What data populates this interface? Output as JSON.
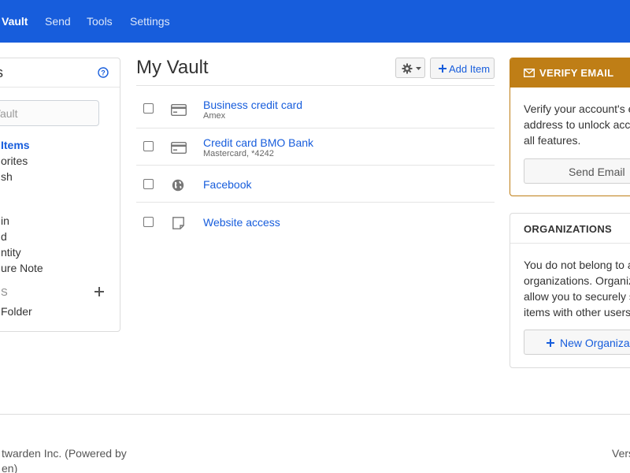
{
  "nav": {
    "items": [
      {
        "label": "Vault",
        "active": true
      },
      {
        "label": "Send",
        "active": false
      },
      {
        "label": "Tools",
        "active": false
      },
      {
        "label": "Settings",
        "active": false
      }
    ]
  },
  "filters": {
    "title": "s",
    "search_placeholder": "n Vault",
    "all_items": "Items",
    "favorites": "orites",
    "trash": "sh",
    "types": [
      "in",
      "d",
      "ntity",
      "ure Note"
    ],
    "folders_label": "S",
    "no_folder": "Folder"
  },
  "main": {
    "title": "My Vault",
    "add_item_label": "Add Item",
    "items": [
      {
        "name": "Business credit card",
        "sub": "Amex",
        "type": "card-icon"
      },
      {
        "name": "Credit card BMO Bank",
        "sub": "Mastercard, *4242",
        "type": "card-icon"
      },
      {
        "name": "Facebook",
        "sub": "",
        "type": "globe-icon"
      },
      {
        "name": "Website access",
        "sub": "",
        "type": "note-icon"
      }
    ]
  },
  "verify": {
    "title": "VERIFY EMAIL",
    "lines": [
      "Verify your account's e",
      "address to unlock acce",
      "all features."
    ],
    "button": "Send Email"
  },
  "orgs": {
    "title": "ORGANIZATIONS",
    "lines": [
      "You do not belong to a",
      "organizations. Organiz",
      "allow you to securely s",
      "items with other users"
    ],
    "button": "New Organizat"
  },
  "footer": {
    "line1": "twarden Inc. (Powered by",
    "line2": "en)",
    "version": "Vers"
  },
  "colors": {
    "brand": "#175ddc",
    "warning": "#bf7e16"
  }
}
